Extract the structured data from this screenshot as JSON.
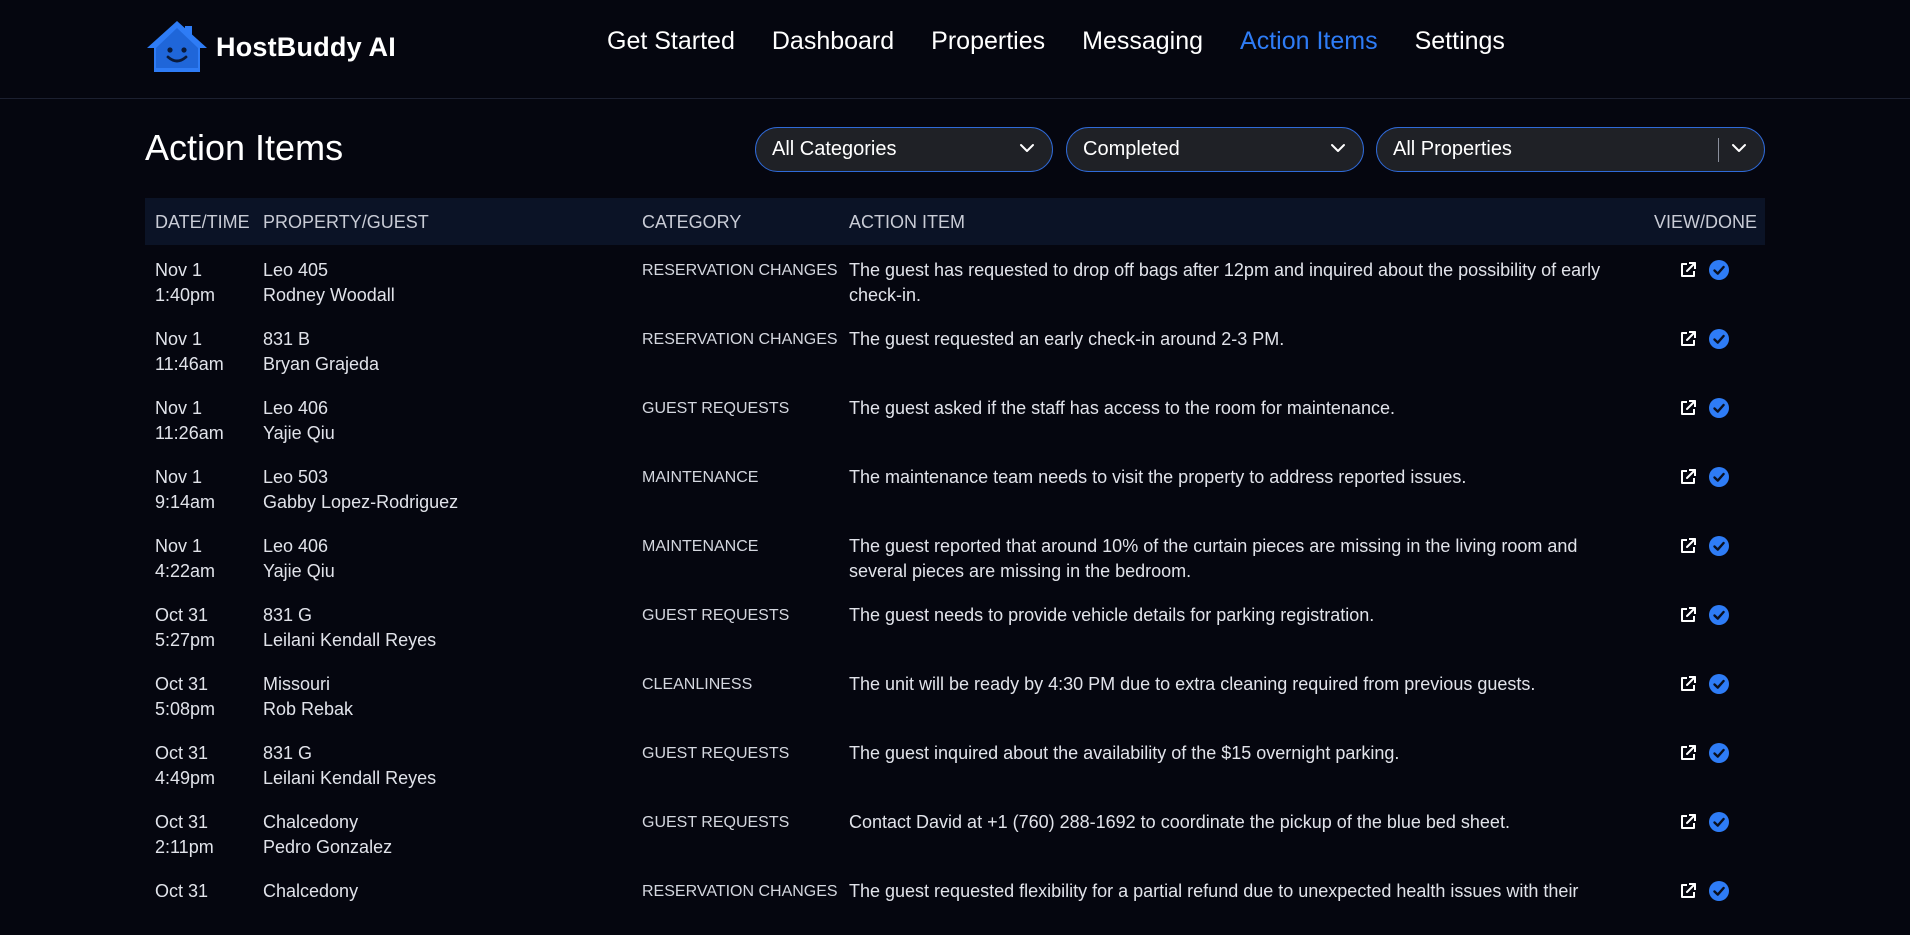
{
  "app": {
    "name": "HostBuddy AI"
  },
  "nav": [
    {
      "label": "Get Started"
    },
    {
      "label": "Dashboard"
    },
    {
      "label": "Properties"
    },
    {
      "label": "Messaging"
    },
    {
      "label": "Action Items",
      "active": true
    },
    {
      "label": "Settings"
    }
  ],
  "page": {
    "title": "Action Items"
  },
  "filters": {
    "category": "All Categories",
    "status": "Completed",
    "property": "All Properties"
  },
  "table": {
    "headers": {
      "datetime": "DATE/TIME",
      "property_guest": "PROPERTY/GUEST",
      "category": "CATEGORY",
      "action_item": "ACTION ITEM",
      "view_done": "VIEW/DONE"
    },
    "rows": [
      {
        "date": "Nov 1",
        "time": "1:40pm",
        "property": "Leo 405",
        "guest": "Rodney Woodall",
        "category": "RESERVATION CHANGES",
        "item": "The guest has requested to drop off bags after 12pm and inquired about the possibility of early check-in."
      },
      {
        "date": "Nov 1",
        "time": "11:46am",
        "property": "831 B",
        "guest": "Bryan Grajeda",
        "category": "RESERVATION CHANGES",
        "item": "The guest requested an early check-in around 2-3 PM."
      },
      {
        "date": "Nov 1",
        "time": "11:26am",
        "property": "Leo 406",
        "guest": "Yajie Qiu",
        "category": "GUEST REQUESTS",
        "item": "The guest asked if the staff has access to the room for maintenance."
      },
      {
        "date": "Nov 1",
        "time": "9:14am",
        "property": "Leo 503",
        "guest": "Gabby Lopez-Rodriguez",
        "category": "MAINTENANCE",
        "item": "The maintenance team needs to visit the property to address reported issues."
      },
      {
        "date": "Nov 1",
        "time": "4:22am",
        "property": "Leo 406",
        "guest": "Yajie Qiu",
        "category": "MAINTENANCE",
        "item": "The guest reported that around 10% of the curtain pieces are missing in the living room and several pieces are missing in the bedroom."
      },
      {
        "date": "Oct 31",
        "time": "5:27pm",
        "property": "831 G",
        "guest": "Leilani Kendall Reyes",
        "category": "GUEST REQUESTS",
        "item": "The guest needs to provide vehicle details for parking registration."
      },
      {
        "date": "Oct 31",
        "time": "5:08pm",
        "property": "Missouri",
        "guest": "Rob Rebak",
        "category": "CLEANLINESS",
        "item": "The unit will be ready by 4:30 PM due to extra cleaning required from previous guests."
      },
      {
        "date": "Oct 31",
        "time": "4:49pm",
        "property": "831 G",
        "guest": "Leilani Kendall Reyes",
        "category": "GUEST REQUESTS",
        "item": "The guest inquired about the availability of the $15 overnight parking."
      },
      {
        "date": "Oct 31",
        "time": "2:11pm",
        "property": "Chalcedony",
        "guest": "Pedro Gonzalez",
        "category": "GUEST REQUESTS",
        "item": "Contact David at +1 (760) 288-1692 to coordinate the pickup of the blue bed sheet."
      },
      {
        "date": "Oct 31",
        "time": "",
        "property": "Chalcedony",
        "guest": "",
        "category": "RESERVATION CHANGES",
        "item": "The guest requested flexibility for a partial refund due to unexpected health issues with their"
      }
    ]
  },
  "colors": {
    "background": "#05060f",
    "accent": "#2e7cf6",
    "header_row": "#0b1326",
    "select_bg": "#1f2126"
  },
  "icons": {
    "logo": "house-smiley-logo",
    "view": "external-link-icon",
    "done": "check-circle-icon",
    "dropdown": "chevron-down-icon"
  }
}
